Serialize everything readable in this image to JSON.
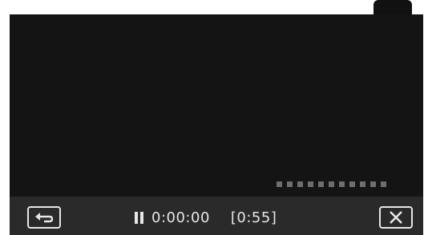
{
  "player": {
    "elapsed_time": "0:00:00",
    "remaining_time": "[0:55]",
    "state": "paused"
  },
  "controls": {
    "back_icon": "return-arrow-icon",
    "pause_icon": "pause-icon",
    "close_icon": "close-x-icon"
  },
  "colors": {
    "screen_bg": "#111111",
    "bar_bg": "#2a2a2a",
    "foreground": "#e6e6e6",
    "progress_dots": "#6e6e6e"
  }
}
